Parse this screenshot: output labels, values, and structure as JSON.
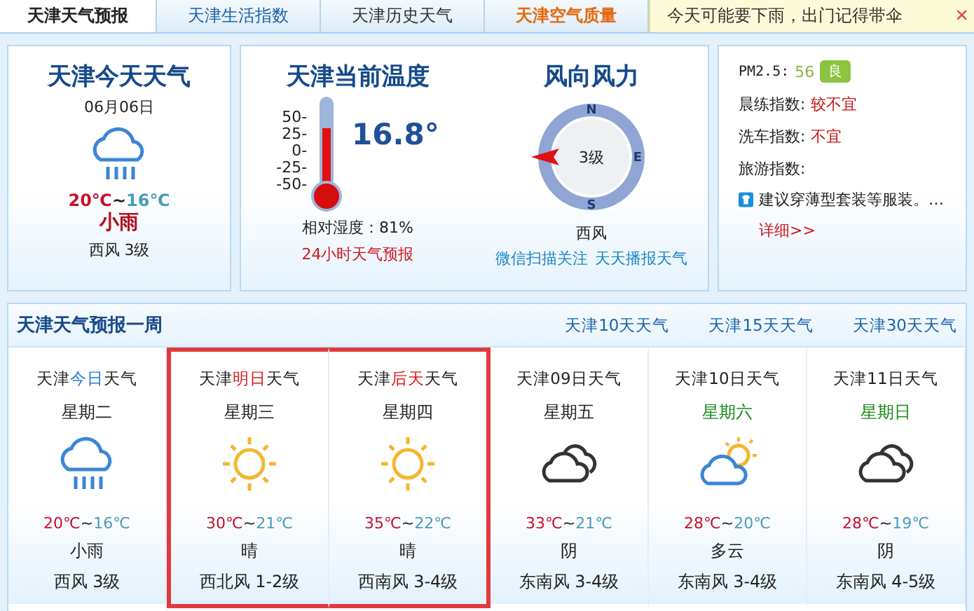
{
  "tabs": [
    {
      "label": "天津天气预报",
      "selected": true,
      "kind": "plain"
    },
    {
      "label": "天津生活指数",
      "selected": false,
      "kind": "link"
    },
    {
      "label": "天津历史天气",
      "selected": false,
      "kind": "plain"
    },
    {
      "label": "天津空气质量",
      "selected": false,
      "kind": "alert"
    }
  ],
  "notice": {
    "text": "今天可能要下雨，出门记得带伞",
    "close": "×"
  },
  "today": {
    "title": "天津今天天气",
    "date": "06月06日",
    "kind": "rain",
    "high": "20℃",
    "sep": "~",
    "low": "16℃",
    "condition": "小雨",
    "wind": "西风 3级"
  },
  "current": {
    "title": "天津当前温度",
    "scale": [
      "50-",
      "25-",
      "0-",
      "-25-",
      "-50-"
    ],
    "level": 0.67,
    "temperature": "16.8°",
    "humidity": "相对湿度：81%",
    "link": "24小时天气预报"
  },
  "wind": {
    "title": "风向风力",
    "compass": [
      "N",
      "E",
      "S"
    ],
    "force": "3级",
    "direction": "西风",
    "links": [
      "微信扫描关注",
      "天天播报天气"
    ]
  },
  "indices": {
    "pm_label": "PM2.5:",
    "pm_value": "56",
    "pm_badge": "良",
    "items": [
      {
        "label": "晨练指数:",
        "value": "较不宜"
      },
      {
        "label": "洗车指数:",
        "value": "不宜"
      },
      {
        "label": "旅游指数:",
        "value": ""
      }
    ],
    "advice": "建议穿薄型套装等服装。…",
    "more": "详细>>"
  },
  "week": {
    "title": "天津天气预报一周",
    "links": [
      "天津10天天气",
      "天津15天天气",
      "天津30天天气"
    ],
    "days": [
      {
        "title": [
          {
            "text": "天津"
          },
          {
            "text": "今日",
            "kind": "today"
          },
          {
            "text": "天气"
          }
        ],
        "weekday": "星期二",
        "weekend": false,
        "kind": "rain",
        "high": "20℃",
        "sep": "~",
        "low": "16℃",
        "condition": "小雨",
        "wind": "西风 3级",
        "selected": false
      },
      {
        "title": [
          {
            "text": "天津"
          },
          {
            "text": "明日",
            "kind": "ahead"
          },
          {
            "text": "天气"
          }
        ],
        "weekday": "星期三",
        "weekend": false,
        "kind": "sunny",
        "high": "30℃",
        "sep": "~",
        "low": "21℃",
        "condition": "晴",
        "wind": "西北风 1-2级",
        "selected": true
      },
      {
        "title": [
          {
            "text": "天津"
          },
          {
            "text": "后天",
            "kind": "ahead"
          },
          {
            "text": "天气"
          }
        ],
        "weekday": "星期四",
        "weekend": false,
        "kind": "sunny",
        "high": "35℃",
        "sep": "~",
        "low": "22℃",
        "condition": "晴",
        "wind": "西南风 3-4级",
        "selected": true
      },
      {
        "title": [
          {
            "text": "天津09日天气"
          }
        ],
        "weekday": "星期五",
        "weekend": false,
        "kind": "overcast",
        "high": "33℃",
        "sep": "~",
        "low": "21℃",
        "condition": "阴",
        "wind": "东南风 3-4级",
        "selected": false
      },
      {
        "title": [
          {
            "text": "天津10日天气"
          }
        ],
        "weekday": "星期六",
        "weekend": true,
        "kind": "partly_cloudy",
        "high": "28℃",
        "sep": "~",
        "low": "20℃",
        "condition": "多云",
        "wind": "东南风 3-4级",
        "selected": false
      },
      {
        "title": [
          {
            "text": "天津11日天气"
          }
        ],
        "weekday": "星期日",
        "weekend": true,
        "kind": "overcast",
        "high": "28℃",
        "sep": "~",
        "low": "19℃",
        "condition": "阴",
        "wind": "东南风 4-5级",
        "selected": false
      }
    ]
  }
}
